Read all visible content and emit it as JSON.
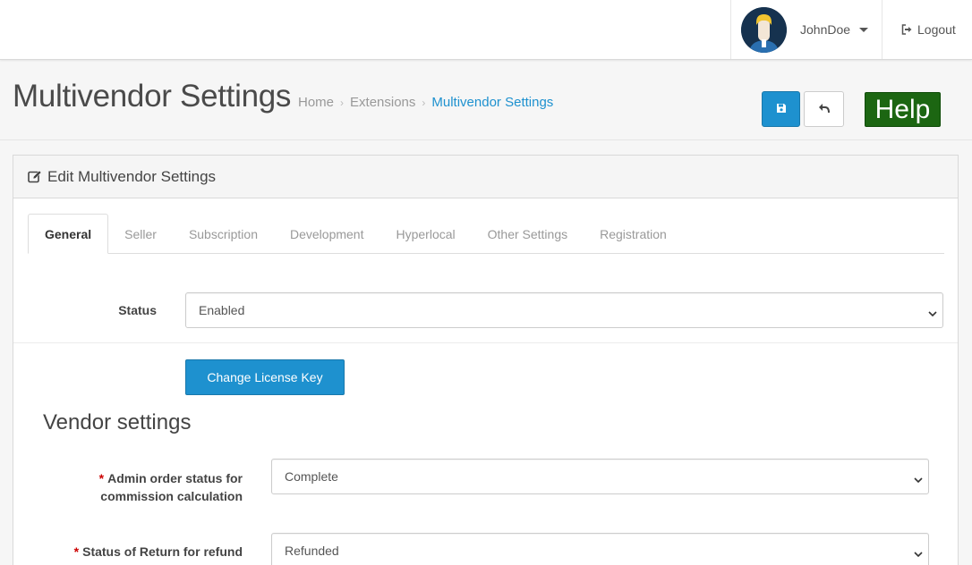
{
  "header": {
    "username": "JohnDoe",
    "logout_label": "Logout"
  },
  "page": {
    "title": "Multivendor Settings",
    "breadcrumb": [
      "Home",
      "Extensions",
      "Multivendor Settings"
    ],
    "help_label": "Help"
  },
  "panel": {
    "title": "Edit Multivendor Settings",
    "tabs": [
      "General",
      "Seller",
      "Subscription",
      "Development",
      "Hyperlocal",
      "Other Settings",
      "Registration"
    ],
    "active_tab": "General"
  },
  "form": {
    "status_label": "Status",
    "status_value": "Enabled",
    "license_button": "Change License Key",
    "section_title": "Vendor settings",
    "required_mark": "*",
    "admin_order_label_line1": "Admin order status for",
    "admin_order_label_line2": "commission calculation",
    "admin_order_value": "Complete",
    "return_status_label": "Status of Return for refund",
    "return_status_value": "Refunded"
  },
  "colors": {
    "primary": "#1e91cf",
    "help_green": "#1c6612",
    "required_red": "#cc0000"
  }
}
